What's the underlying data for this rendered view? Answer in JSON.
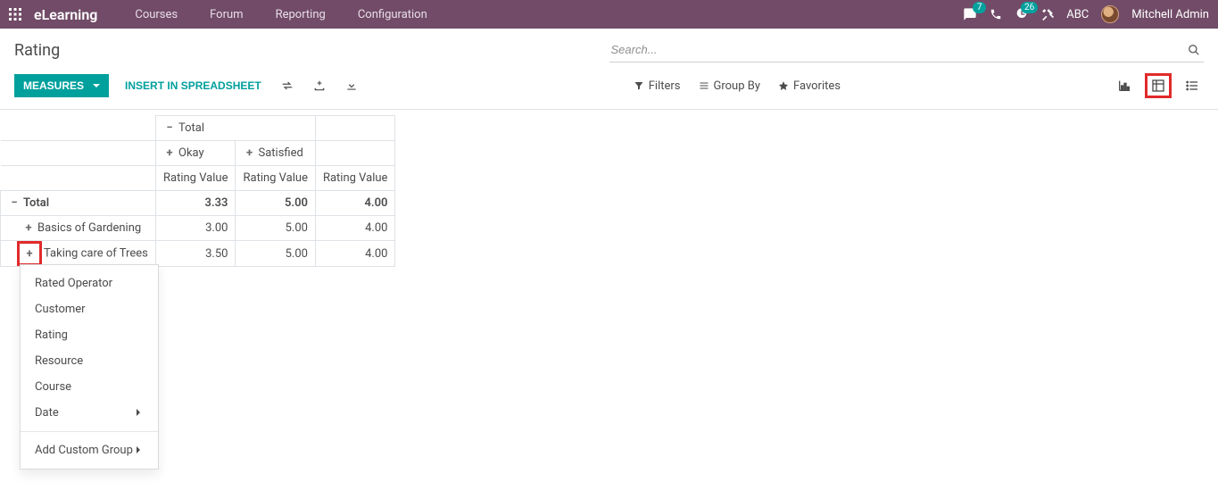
{
  "brand": "eLearning",
  "nav": {
    "links": [
      "Courses",
      "Forum",
      "Reporting",
      "Configuration"
    ],
    "msg_badge": "7",
    "moon_badge": "26",
    "company": "ABC",
    "user": "Mitchell Admin"
  },
  "page_title": "Rating",
  "search": {
    "placeholder": "Search..."
  },
  "cp": {
    "measures": "MEASURES",
    "insert": "INSERT IN SPREADSHEET",
    "filters": "Filters",
    "groupby": "Group By",
    "favorites": "Favorites"
  },
  "pivot": {
    "col_total": "Total",
    "col_groups": [
      "Okay",
      "Satisfied"
    ],
    "measure_label": "Rating Value",
    "row_total": "Total",
    "rows": [
      {
        "label": "Basics of Gardening",
        "vals": [
          "3.00",
          "5.00",
          "4.00"
        ]
      },
      {
        "label": "Taking care of Trees",
        "vals": [
          "3.50",
          "5.00",
          "4.00"
        ]
      }
    ],
    "total_vals": [
      "3.33",
      "5.00",
      "4.00"
    ]
  },
  "dropdown": {
    "items": [
      "Rated Operator",
      "Customer",
      "Rating",
      "Resource",
      "Course"
    ],
    "date": "Date",
    "add_custom": "Add Custom Group"
  }
}
